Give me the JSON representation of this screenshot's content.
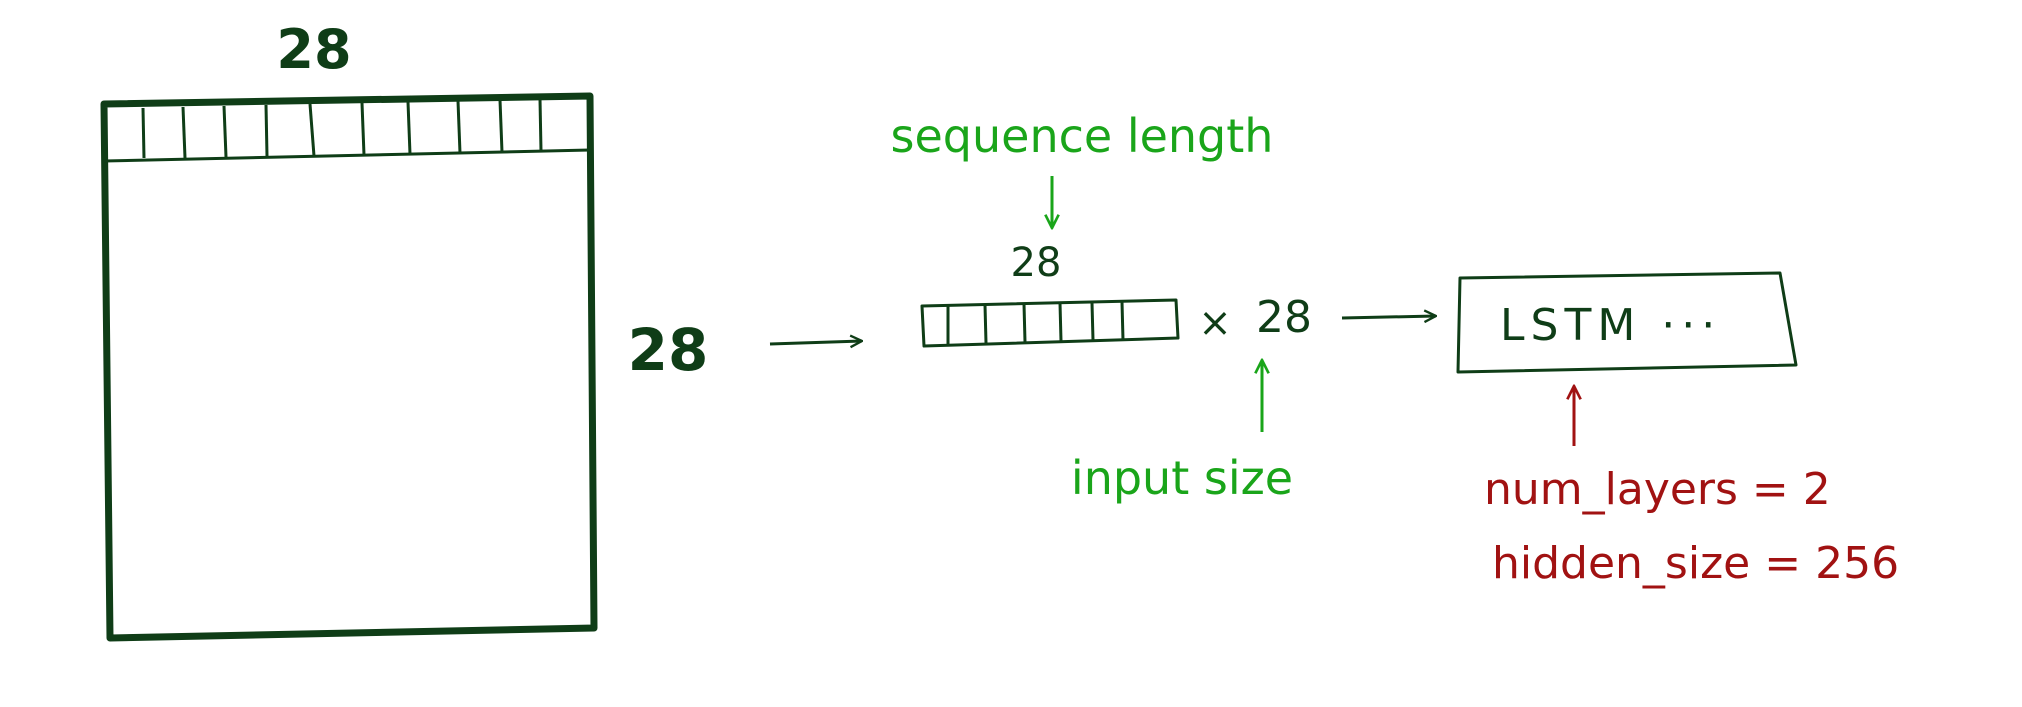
{
  "colors": {
    "ink": "#0f3d17",
    "green": "#1aa51a",
    "red": "#a11212",
    "background": "#ffffff"
  },
  "image": {
    "width_label": "28",
    "height_label": "28"
  },
  "sequence": {
    "length_caption": "sequence length",
    "length_value": "28",
    "multiplier_symbol": "×",
    "multiplier_value": "28",
    "input_caption": "input size"
  },
  "lstm": {
    "label": "LSTM ···",
    "num_layers_text": "num_layers = 2",
    "hidden_size_text": "hidden_size = 256"
  }
}
